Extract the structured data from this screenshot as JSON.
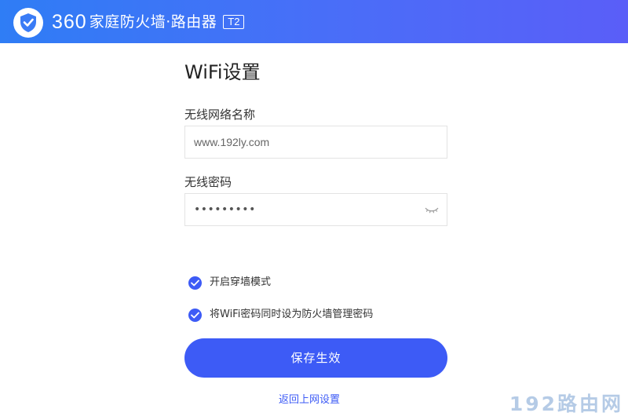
{
  "header": {
    "brand_number": "360",
    "brand_text": "家庭防火墙·路由器",
    "model_tag": "T2",
    "logo_icon": "shield-icon",
    "gradient_colors": [
      "#2f7df5",
      "#5a5ef8"
    ]
  },
  "page": {
    "title": "WiFi设置"
  },
  "ssid": {
    "label": "无线网络名称",
    "value": "www.192ly.com"
  },
  "password": {
    "label": "无线密码",
    "masked_value": "•••••••••",
    "toggle_icon": "eye-closed-icon"
  },
  "options": [
    {
      "label": "开启穿墙模式",
      "checked": true
    },
    {
      "label": "将WiFi密码同时设为防火墙管理密码",
      "checked": true
    }
  ],
  "actions": {
    "save_label": "保存生效",
    "back_label": "返回上网设置"
  },
  "watermark": "192路由网",
  "colors": {
    "accent": "#3d5bf6",
    "header": "#2f7df5"
  }
}
